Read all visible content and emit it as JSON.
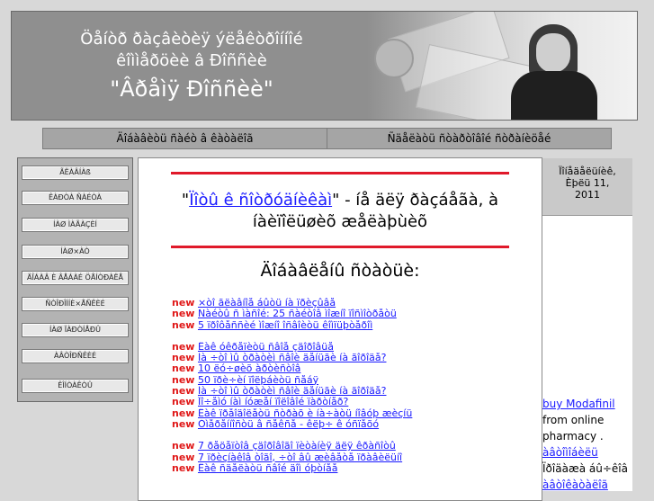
{
  "header": {
    "line1": "Öåíòð ðàçâèòèÿ ýëåêòðîííîé",
    "line2": "êîììåðöèè â Ðîññèè",
    "line3": "\"Âðåìÿ Ðîññèè\""
  },
  "nav": {
    "items": [
      "Äîáàâèòü ñàéò â êàòàëîã",
      "Ñäåëàòü ñòàðòîâîé ñòðàíèöåé"
    ]
  },
  "sidebar": {
    "items": [
      "ÃËÀÂÍÀß",
      "ÊÀÐÒÀ ÑÀÉÒÀ",
      "ÍÀØ ÌÀÃÀÇÈÍ",
      "ÍÀØ×ÀÒ",
      "ÄÎÁÀÂ È ÂÅÁÀÉ ÖÅÍÒÐÀËÅ",
      "ÑÒÎÐÎÍÍÈ×ÅÑÊÈÉ",
      "ÍÀØ ÏÀÐÒÍÅÐÛ",
      "ÀÂÒÎÐÑÊÈÉ",
      "ÊÎÍÒÀÊÒÛ"
    ]
  },
  "main": {
    "headline_pre": "\"",
    "headline_link": "Ïîòû ê ñîòðóäíèêàì",
    "headline_post": "\" - íå äëÿ ðàçáåãà, à íàèïîëüøèõ æåëàþùèõ",
    "subhead": "Äîáàâëåíû ñòàòüè:",
    "links_group1": [
      {
        "badge": "new",
        "text": "×òî ãëàâíîå áûòü íà ïðèçûâå"
      },
      {
        "badge": "new",
        "text": "Ñàéòû ñ ìàñîé: 25 ñàéòîâ ìîæíî ïîñìîòðåòü"
      },
      {
        "badge": "new",
        "text": "5 ïðîôåññèé ìîæíî îñâîèòü êîìïüþòåðîì"
      }
    ],
    "links_group2": [
      {
        "badge": "new",
        "text": "Êàê óêðåïèòü ñâîå çäîðîâüå"
      },
      {
        "badge": "new",
        "text": "Íà ÷òî ìû òðàòèì ñâîè äåíüãè íà ãîðîäå?"
      },
      {
        "badge": "new",
        "text": "10 ëó÷øèõ àðòèñòîâ"
      },
      {
        "badge": "new",
        "text": "50 ïðè÷èí ïîëþáèòü ñåáÿ"
      },
      {
        "badge": "new",
        "text": "Íà ÷òî ìû òðàòèì ñâîè äåíüãè íà ãîðîäå?"
      },
      {
        "badge": "new",
        "text": "Ïî÷åìó íàì íóæåí ïîëîâîé ïàðòíåð?"
      },
      {
        "badge": "new",
        "text": "Êàê ïðåîäîëåòü ñòðàõ è íà÷àòü íîâóþ æèçíü"
      },
      {
        "badge": "new",
        "text": "Óìåðåííîñòü â ñåêñå - êëþ÷ ê óñïåõó"
      }
    ],
    "links_group3": [
      {
        "badge": "new",
        "text": "7 ðåöåïòîâ çäîðîâîãî ïèòàíèÿ äëÿ êðàñîòû"
      },
      {
        "badge": "new",
        "text": "7 ïðèçíàêîâ òîãî, ÷òî âû æèâåòå ïðàâèëüíî"
      },
      {
        "badge": "new",
        "text": "Êàê ñäåëàòü ñâîé äîì óþòíåå"
      }
    ]
  },
  "right": {
    "date_line1": "Ïîíåäåëüíèê,",
    "date_line2": "Èþëü 11,",
    "date_line3": "2011",
    "ad_link": "buy Modafinil",
    "ad_text1": "from online",
    "ad_text2": "pharmacy .",
    "ad_link2": "àâòîìîáèëü",
    "ad_text3": "Ïðîäàæà áû÷êîâ",
    "ad_link3": "àâòîêàòàëîã"
  }
}
